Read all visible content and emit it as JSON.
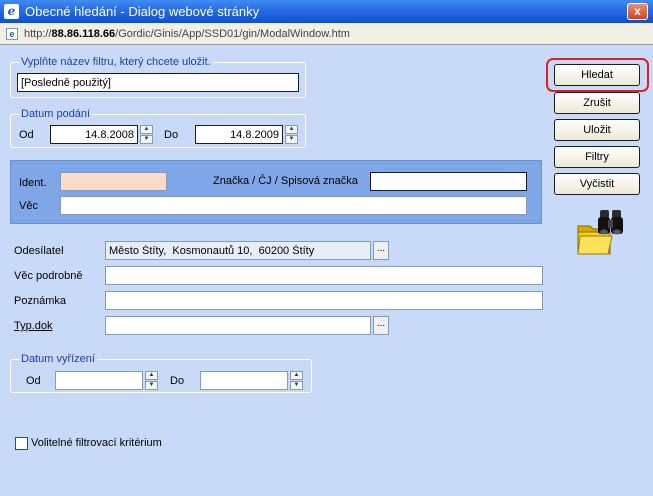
{
  "window": {
    "title": "Obecné hledání - Dialog webové stránky",
    "close_label": "x",
    "url_prefix": "http://",
    "url_host": "88.86.118.66",
    "url_path": "/Gordic/Ginis/App/SSD01/gin/ModalWindow.htm"
  },
  "filter_name": {
    "legend": "Vyplňte název filtru, který chcete uložit.",
    "value": "[Posledně použitý]"
  },
  "datum_podani": {
    "legend": "Datum podání",
    "od_label": "Od",
    "od_value": "14.8.2008",
    "do_label": "Do",
    "do_value": "14.8.2009"
  },
  "ident_panel": {
    "ident_label": "Ident.",
    "ident_value": "",
    "znacka_label": "Značka  / ČJ / Spisová značka",
    "znacka_value": "",
    "vec_label": "Věc",
    "vec_value": ""
  },
  "fields": {
    "odesilatel_label": "Odesílatel",
    "odesilatel_value": "Město Štíty,  Kosmonautů 10,  60200 Štíty",
    "vec_podrobne_label": "Věc podrobně",
    "vec_podrobne_value": "",
    "poznamka_label": "Poznámka",
    "poznamka_value": "",
    "typ_dok_label": "Typ.dok",
    "typ_dok_value": "",
    "dots_label": "..."
  },
  "datum_vyrizeni": {
    "legend": "Datum vyřízení",
    "od_label": "Od",
    "od_value": "",
    "do_label": "Do",
    "do_value": ""
  },
  "optional_filter": {
    "label": "Volitelné filtrovací kritérium",
    "checked": false
  },
  "buttons": {
    "hledat": "Hledat",
    "zrusit": "Zrušit",
    "ulozit": "Uložit",
    "filtry": "Filtry",
    "vycistit": "Vyčistit"
  },
  "icons": {
    "app": "ie-logo-icon",
    "search_graphic": "binoculars-folder-icon"
  },
  "colors": {
    "background": "#c9daf8",
    "ident_panel": "#7fa6e6",
    "ident_field": "#fbdccc",
    "highlight_ring": "#e02020",
    "legend_text": "#1c3fa8"
  }
}
